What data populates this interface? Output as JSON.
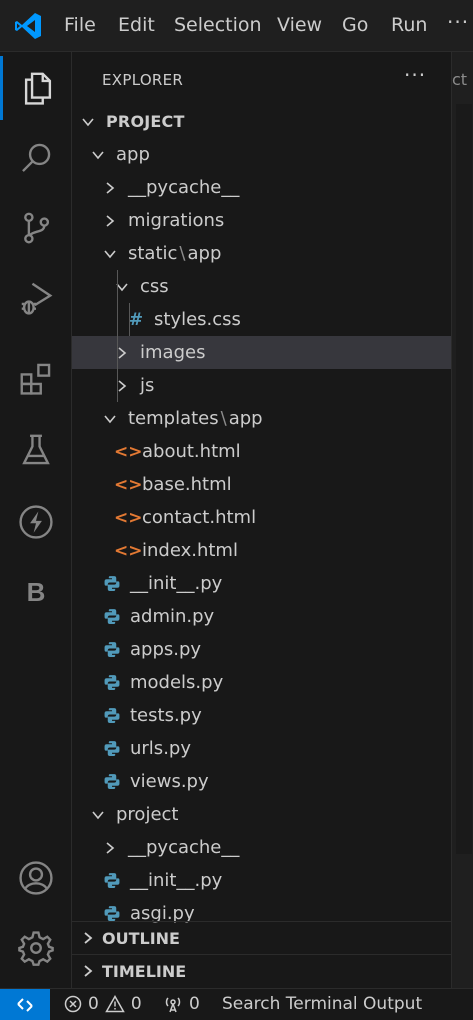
{
  "menu": {
    "file": "File",
    "edit": "Edit",
    "selection": "Selection",
    "view": "View",
    "go": "Go",
    "run": "Run",
    "more": "···"
  },
  "sidebar": {
    "title": "EXPLORER",
    "more": "···",
    "tree": [
      {
        "label": "PROJECT",
        "type": "section",
        "expanded": true
      },
      {
        "label": "app",
        "type": "folder",
        "expanded": true
      },
      {
        "label": "__pycache__",
        "type": "folder",
        "expanded": false
      },
      {
        "label": "migrations",
        "type": "folder",
        "expanded": false
      },
      {
        "label": "static",
        "sep": "\\",
        "label2": "app",
        "type": "folder",
        "expanded": true
      },
      {
        "label": "css",
        "type": "folder",
        "expanded": true
      },
      {
        "label": "styles.css",
        "type": "css",
        "icon": "#"
      },
      {
        "label": "images",
        "type": "folder",
        "expanded": false,
        "selected": true
      },
      {
        "label": "js",
        "type": "folder",
        "expanded": false
      },
      {
        "label": "templates",
        "sep": "\\",
        "label2": "app",
        "type": "folder",
        "expanded": true
      },
      {
        "label": "about.html",
        "type": "html",
        "icon": "<>"
      },
      {
        "label": "base.html",
        "type": "html",
        "icon": "<>"
      },
      {
        "label": "contact.html",
        "type": "html",
        "icon": "<>"
      },
      {
        "label": "index.html",
        "type": "html",
        "icon": "<>"
      },
      {
        "label": "__init__.py",
        "type": "python"
      },
      {
        "label": "admin.py",
        "type": "python"
      },
      {
        "label": "apps.py",
        "type": "python"
      },
      {
        "label": "models.py",
        "type": "python"
      },
      {
        "label": "tests.py",
        "type": "python"
      },
      {
        "label": "urls.py",
        "type": "python"
      },
      {
        "label": "views.py",
        "type": "python"
      },
      {
        "label": "project",
        "type": "folder",
        "expanded": true
      },
      {
        "label": "__pycache__",
        "type": "folder",
        "expanded": false
      },
      {
        "label": "__init__.py",
        "type": "python"
      },
      {
        "label": "asgi.py",
        "type": "python"
      }
    ],
    "outline": "OUTLINE",
    "timeline": "TIMELINE"
  },
  "activity": {
    "extra_letter": "B"
  },
  "editor": {
    "tab_fragment": "ct"
  },
  "status": {
    "errors": "0",
    "warnings": "0",
    "ports": "0",
    "search": "Search Terminal Output"
  },
  "colors": {
    "accent": "#0078d4",
    "css_icon": "#519aba",
    "html_icon": "#e37933",
    "python_icon": "#519aba"
  }
}
